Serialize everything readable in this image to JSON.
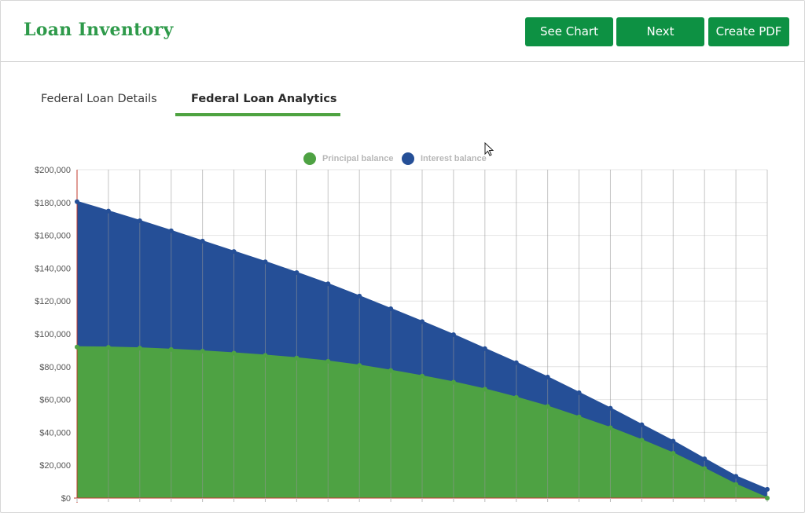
{
  "header": {
    "title": "Loan Inventory",
    "buttons": {
      "see_chart": "See Chart",
      "next": "Next",
      "create_pdf": "Create PDF"
    }
  },
  "tabs": [
    {
      "label": "Federal Loan Details",
      "active": false
    },
    {
      "label": "Federal Loan Analytics",
      "active": true
    }
  ],
  "colors": {
    "brand_green": "#0d9143",
    "title_green": "#2e9a4a",
    "principal": "#4ea243",
    "interest": "#254f97"
  },
  "chart_data": {
    "type": "area",
    "stacked": false,
    "legend": [
      {
        "name": "Principal balance",
        "color": "#4ea243"
      },
      {
        "name": "Interest balance",
        "color": "#254f97"
      }
    ],
    "ylim": [
      0,
      200000
    ],
    "yticks": [
      "$200,000",
      "$180,000",
      "$160,000",
      "$140,000",
      "$120,000",
      "$100,000",
      "$80,000",
      "$60,000",
      "$40,000",
      "$20,000",
      "$0"
    ],
    "x": [
      0,
      1,
      2,
      3,
      4,
      5,
      6,
      7,
      8,
      9,
      10,
      11,
      12,
      13,
      14,
      15,
      16,
      17,
      18,
      19,
      20,
      21,
      22
    ],
    "series": [
      {
        "name": "Interest balance",
        "values": [
          180500,
          174800,
          168900,
          162800,
          156500,
          150200,
          143900,
          137300,
          130500,
          123000,
          115300,
          107500,
          99500,
          91000,
          82500,
          73700,
          64200,
          54700,
          44700,
          34700,
          23900,
          13300,
          5300
        ]
      },
      {
        "name": "Principal balance",
        "values": [
          92000,
          91800,
          91300,
          90500,
          89500,
          88300,
          86900,
          85300,
          83300,
          80800,
          77700,
          74300,
          70600,
          66300,
          61300,
          55800,
          49400,
          42800,
          35300,
          27300,
          18000,
          8300,
          0
        ]
      }
    ],
    "grid": {
      "vertical": true,
      "horizontal": true
    },
    "legend_position": "top-center"
  }
}
